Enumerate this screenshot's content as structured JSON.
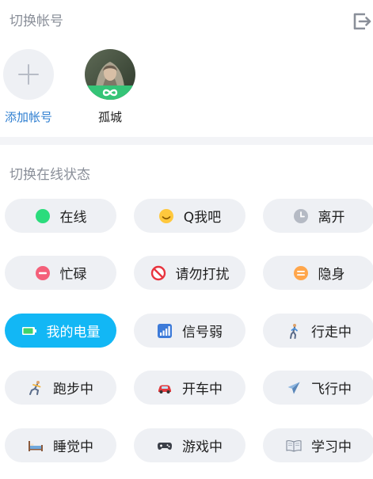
{
  "header": {
    "title": "切换帐号"
  },
  "accounts": [
    {
      "label": "添加帐号"
    },
    {
      "label": "孤城"
    }
  ],
  "status_section": {
    "title": "切换在线状态"
  },
  "statuses": [
    {
      "label": "在线",
      "icon": "online-dot-icon"
    },
    {
      "label": "Q我吧",
      "icon": "smile-icon"
    },
    {
      "label": "离开",
      "icon": "clock-icon"
    },
    {
      "label": "忙碌",
      "icon": "busy-minus-icon"
    },
    {
      "label": "请勿打扰",
      "icon": "no-entry-icon"
    },
    {
      "label": "隐身",
      "icon": "invisible-icon"
    },
    {
      "label": "我的电量",
      "icon": "battery-icon"
    },
    {
      "label": "信号弱",
      "icon": "signal-bars-icon"
    },
    {
      "label": "行走中",
      "icon": "walking-icon"
    },
    {
      "label": "跑步中",
      "icon": "running-icon"
    },
    {
      "label": "开车中",
      "icon": "car-icon"
    },
    {
      "label": "飞行中",
      "icon": "airplane-icon"
    },
    {
      "label": "睡觉中",
      "icon": "bed-icon"
    },
    {
      "label": "游戏中",
      "icon": "gamepad-icon"
    },
    {
      "label": "学习中",
      "icon": "book-icon"
    }
  ],
  "colors": {
    "accent": "#12b7f5",
    "pill_bg": "#eef0f4",
    "link_blue": "#2f7fd1",
    "online_green": "#2bdc7c",
    "busy_red": "#f4607a",
    "invisible_orange": "#ffa64b"
  }
}
